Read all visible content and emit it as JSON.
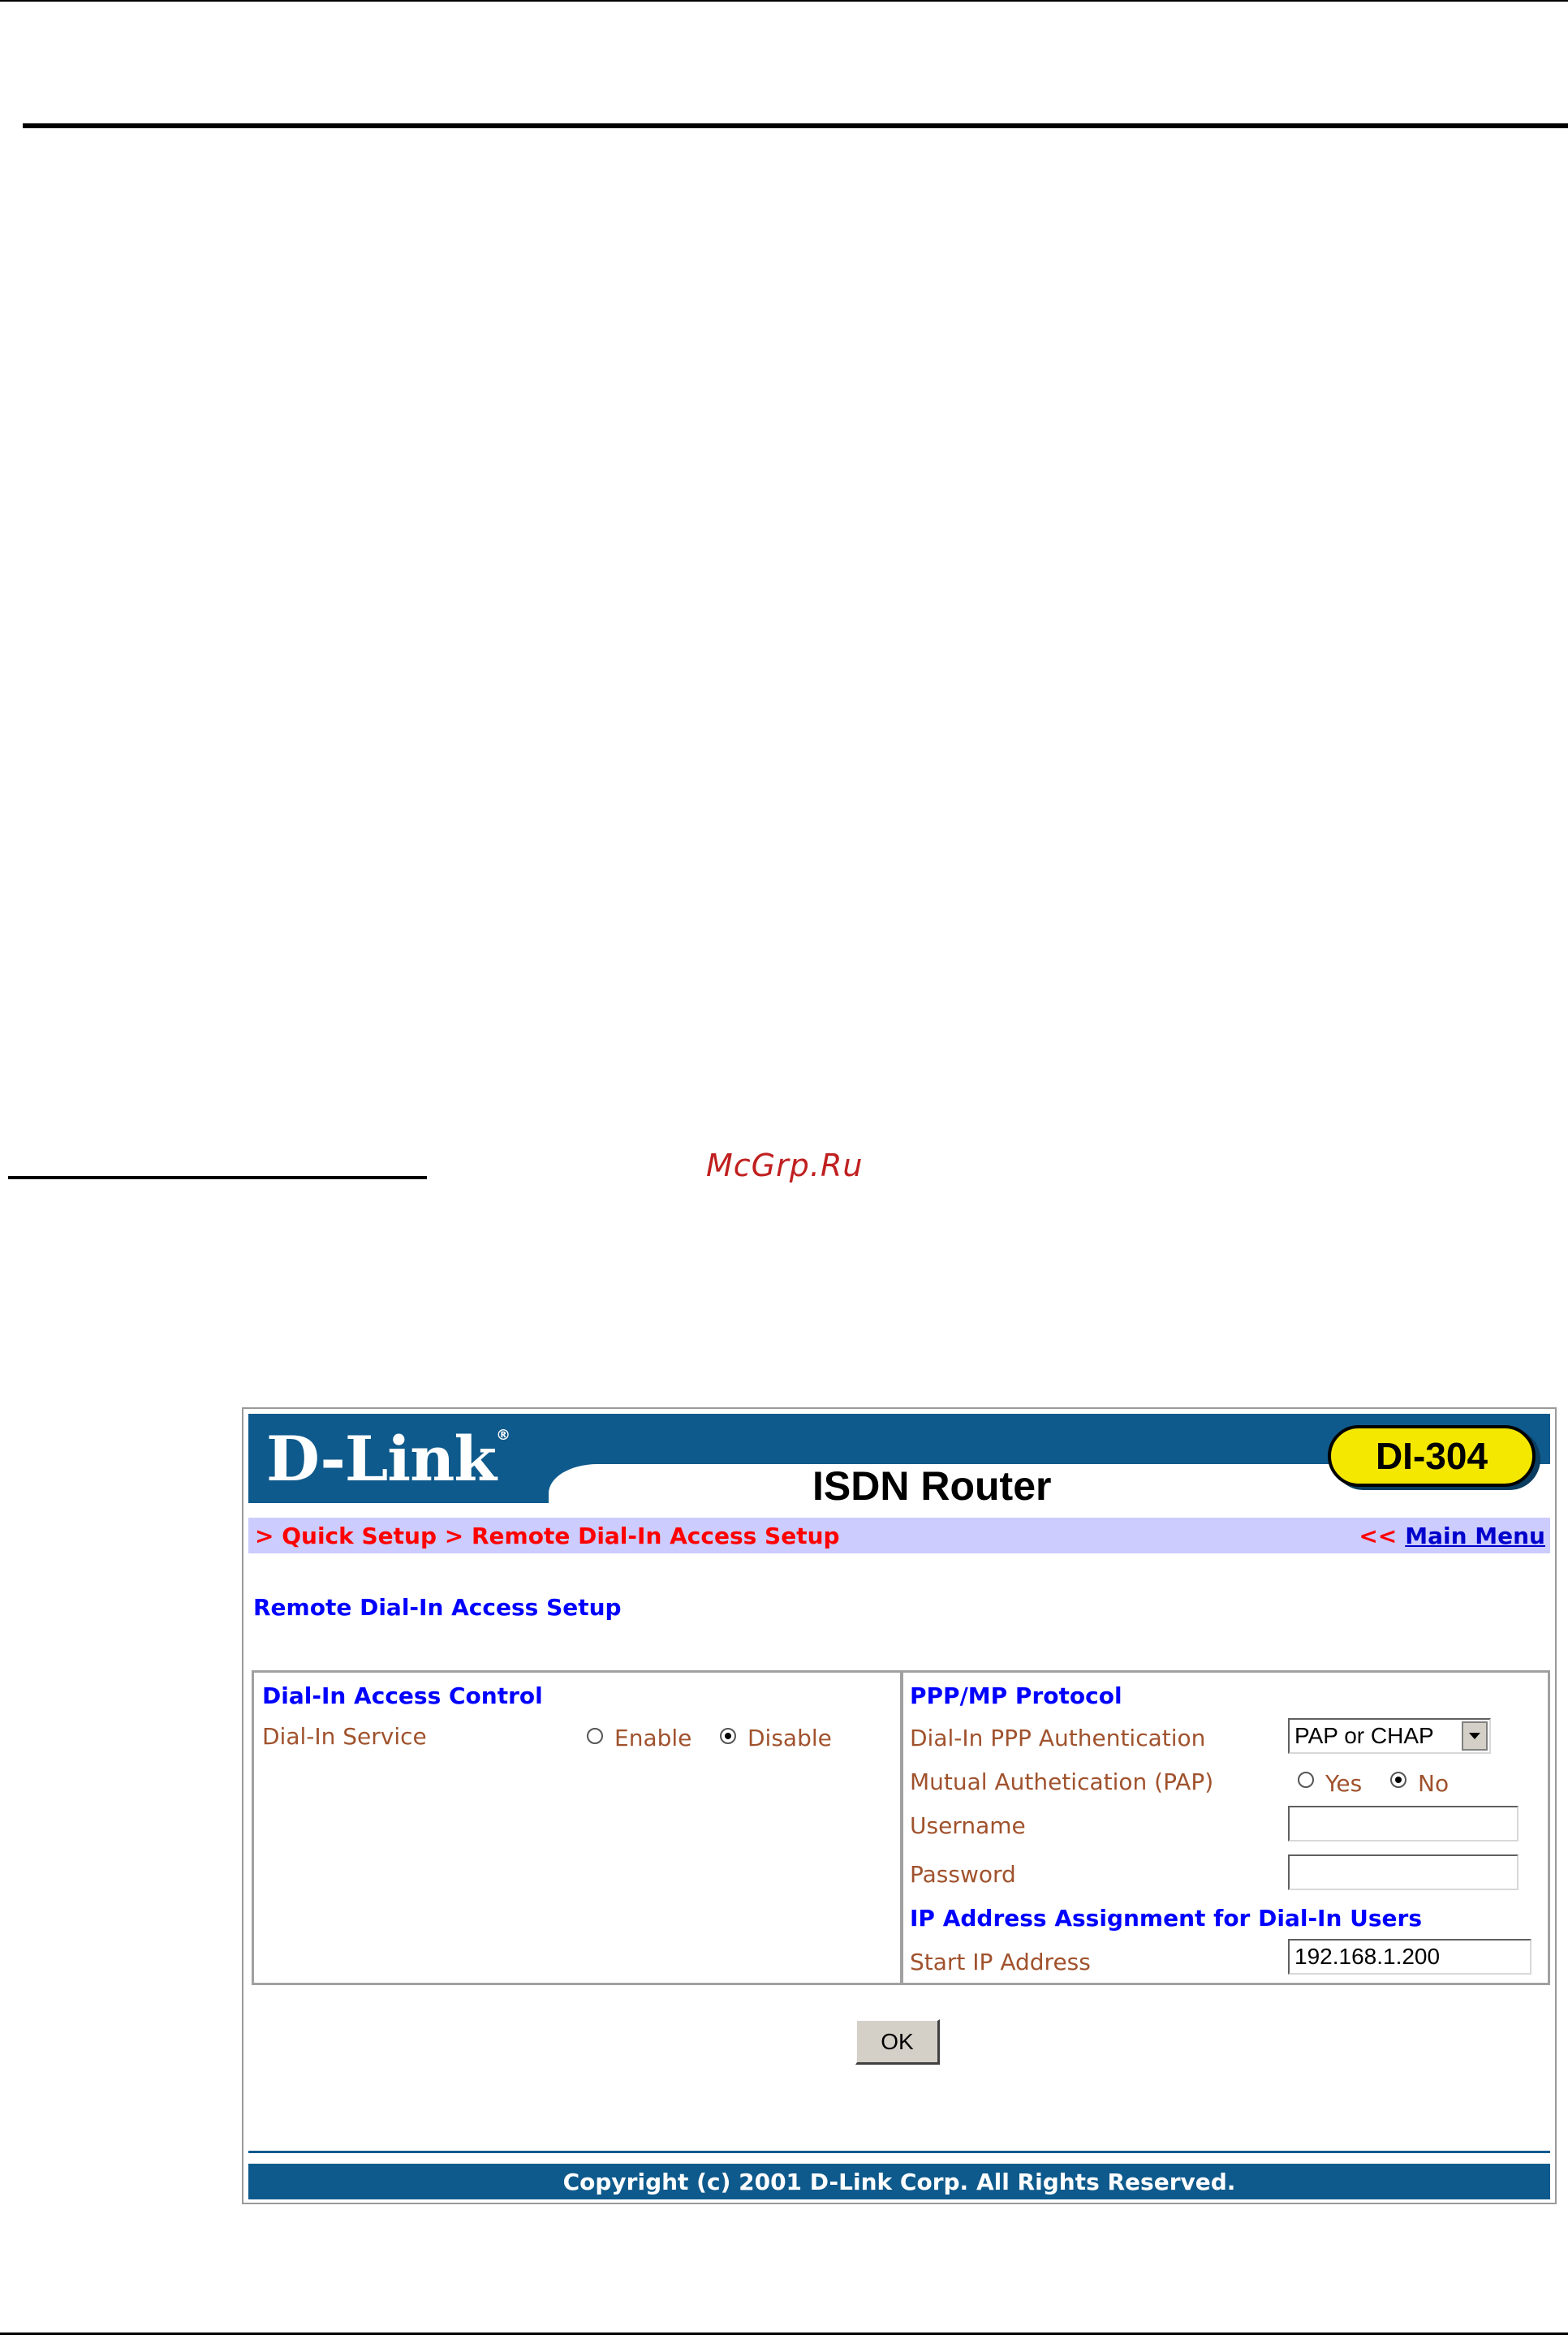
{
  "watermark": "McGrp.Ru",
  "screenshot": {
    "brand_logo": "D-Link",
    "brand_logo_mark": "®",
    "product_title": "ISDN Router",
    "model_badge": "DI-304",
    "breadcrumb": "> Quick Setup > Remote Dial-In Access Setup",
    "main_menu_arrows": "<<",
    "main_menu_link": "Main Menu",
    "page_heading": "Remote Dial-In Access Setup",
    "left_panel": {
      "title": "Dial-In Access Control",
      "dial_in_service_label": "Dial-In Service",
      "enable_label": "Enable",
      "disable_label": "Disable",
      "selected": "Disable"
    },
    "right_panel": {
      "title": "PPP/MP Protocol",
      "auth_label": "Dial-In PPP Authentication",
      "auth_value": "PAP or CHAP",
      "mutual_label": "Mutual Authetication (PAP)",
      "yes_label": "Yes",
      "no_label": "No",
      "mutual_selected": "No",
      "username_label": "Username",
      "username_value": "",
      "password_label": "Password",
      "password_value": "",
      "ip_section_title": "IP Address Assignment for Dial-In Users",
      "start_ip_label": "Start IP Address",
      "start_ip_value": "192.168.1.200"
    },
    "ok_button": "OK",
    "copyright": "Copyright (c) 2001 D-Link Corp. All Rights Reserved."
  }
}
